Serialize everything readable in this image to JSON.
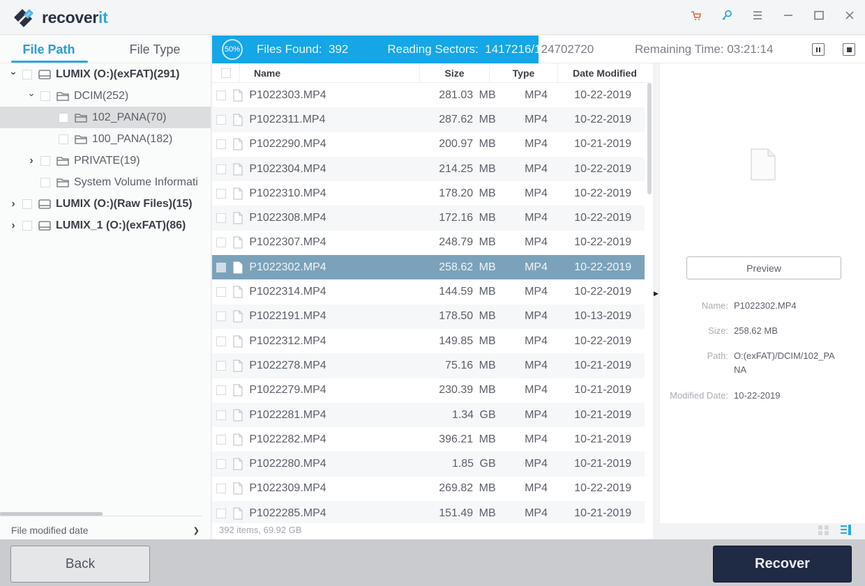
{
  "app": {
    "logo_text_main": "recover",
    "logo_text_accent": "it",
    "colors": {
      "brand_dark": "#2a3142",
      "brand_accent": "#28a9e0",
      "progress": "#14a6e6",
      "selected_row": "#7ba2ba",
      "recover_button": "#1f2a44",
      "cart": "#e0623a",
      "key": "#2aa7df"
    }
  },
  "title_bar": {
    "icons": [
      "cart-icon",
      "key-icon",
      "menu-icon",
      "minimize-icon",
      "maximize-icon",
      "close-icon"
    ]
  },
  "left_panel": {
    "tabs": [
      {
        "label": "File Path",
        "active": true
      },
      {
        "label": "File Type",
        "active": false
      }
    ],
    "tree": [
      {
        "label": "LUMIX (O:)(exFAT)(291)",
        "level": 0,
        "expander": "expanded",
        "icon": "drive-icon",
        "bold": true,
        "selected": false
      },
      {
        "label": "DCIM(252)",
        "level": 1,
        "expander": "expanded",
        "icon": "folder-icon",
        "bold": false,
        "selected": false
      },
      {
        "label": "102_PANA(70)",
        "level": 2,
        "expander": "none",
        "icon": "folder-icon",
        "bold": false,
        "selected": true
      },
      {
        "label": "100_PANA(182)",
        "level": 2,
        "expander": "none",
        "icon": "folder-icon",
        "bold": false,
        "selected": false
      },
      {
        "label": "PRIVATE(19)",
        "level": 1,
        "expander": "collapsed",
        "icon": "folder-icon",
        "bold": false,
        "selected": false
      },
      {
        "label": "System Volume Informati",
        "level": 1,
        "expander": "none",
        "icon": "folder-icon",
        "bold": false,
        "selected": false
      },
      {
        "label": "LUMIX (O:)(Raw Files)(15)",
        "level": 0,
        "expander": "collapsed",
        "icon": "drive-icon",
        "bold": true,
        "selected": false
      },
      {
        "label": "LUMIX_1 (O:)(exFAT)(86)",
        "level": 0,
        "expander": "collapsed",
        "icon": "drive-icon",
        "bold": true,
        "selected": false
      }
    ],
    "filter_label": "File modified date"
  },
  "scan": {
    "percent_label": "50%",
    "progress_fraction": 0.5,
    "files_found_label": "Files Found:",
    "files_found": "392",
    "reading_label": "Reading Sectors:",
    "reading_value_head": "1417216/1",
    "reading_value_tail": "24702720",
    "remaining_label": "Remaining Time:",
    "remaining_value": "03:21:14"
  },
  "table": {
    "columns": {
      "name": "Name",
      "size": "Size",
      "type": "Type",
      "date": "Date Modified"
    },
    "rows": [
      {
        "name": "P1022303.MP4",
        "size": "281.03 MB",
        "type": "MP4",
        "date": "10-22-2019",
        "selected": false
      },
      {
        "name": "P1022311.MP4",
        "size": "287.62 MB",
        "type": "MP4",
        "date": "10-22-2019",
        "selected": false
      },
      {
        "name": "P1022290.MP4",
        "size": "200.97 MB",
        "type": "MP4",
        "date": "10-21-2019",
        "selected": false
      },
      {
        "name": "P1022304.MP4",
        "size": "214.25 MB",
        "type": "MP4",
        "date": "10-22-2019",
        "selected": false
      },
      {
        "name": "P1022310.MP4",
        "size": "178.20 MB",
        "type": "MP4",
        "date": "10-22-2019",
        "selected": false
      },
      {
        "name": "P1022308.MP4",
        "size": "172.16 MB",
        "type": "MP4",
        "date": "10-22-2019",
        "selected": false
      },
      {
        "name": "P1022307.MP4",
        "size": "248.79 MB",
        "type": "MP4",
        "date": "10-22-2019",
        "selected": false
      },
      {
        "name": "P1022302.MP4",
        "size": "258.62 MB",
        "type": "MP4",
        "date": "10-22-2019",
        "selected": true
      },
      {
        "name": "P1022314.MP4",
        "size": "144.59 MB",
        "type": "MP4",
        "date": "10-22-2019",
        "selected": false
      },
      {
        "name": "P1022191.MP4",
        "size": "178.50 MB",
        "type": "MP4",
        "date": "10-13-2019",
        "selected": false
      },
      {
        "name": "P1022312.MP4",
        "size": "149.85 MB",
        "type": "MP4",
        "date": "10-22-2019",
        "selected": false
      },
      {
        "name": "P1022278.MP4",
        "size": "75.16 MB",
        "type": "MP4",
        "date": "10-21-2019",
        "selected": false
      },
      {
        "name": "P1022279.MP4",
        "size": "230.39 MB",
        "type": "MP4",
        "date": "10-21-2019",
        "selected": false
      },
      {
        "name": "P1022281.MP4",
        "size": "1.34 GB",
        "type": "MP4",
        "date": "10-21-2019",
        "selected": false
      },
      {
        "name": "P1022282.MP4",
        "size": "396.21 MB",
        "type": "MP4",
        "date": "10-21-2019",
        "selected": false
      },
      {
        "name": "P1022280.MP4",
        "size": "1.85 GB",
        "type": "MP4",
        "date": "10-21-2019",
        "selected": false
      },
      {
        "name": "P1022309.MP4",
        "size": "269.82 MB",
        "type": "MP4",
        "date": "10-22-2019",
        "selected": false
      },
      {
        "name": "P1022285.MP4",
        "size": "151.49 MB",
        "type": "MP4",
        "date": "10-21-2019",
        "selected": false
      }
    ],
    "status": "392 items, 69.92  GB"
  },
  "preview": {
    "button_label": "Preview",
    "fields": [
      {
        "label": "Name:",
        "value": "P1022302.MP4"
      },
      {
        "label": "Size:",
        "value": "258.62  MB"
      },
      {
        "label": "Path:",
        "value": "O:(exFAT)/DCIM/102_PANA"
      },
      {
        "label": "Modified Date:",
        "value": "10-22-2019"
      }
    ]
  },
  "footer": {
    "back_label": "Back",
    "recover_label": "Recover"
  }
}
